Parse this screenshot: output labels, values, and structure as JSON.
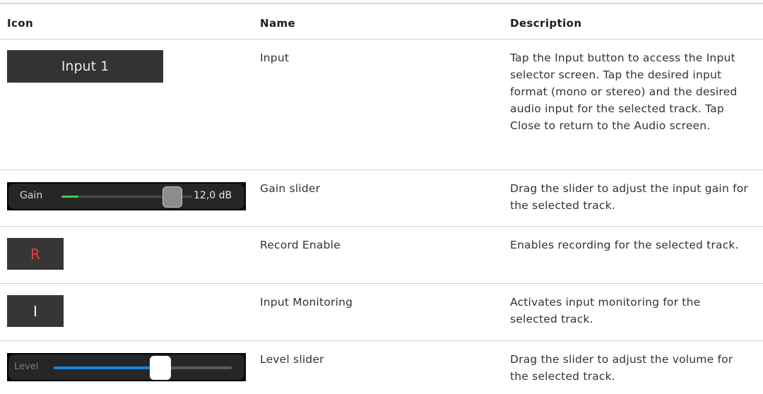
{
  "headers": {
    "icon": "Icon",
    "name": "Name",
    "description": "Description"
  },
  "rows": [
    {
      "icon_label": "Input 1",
      "name": "Input",
      "description": "Tap the Input button to access the Input selector screen. Tap the desired input format (mono or stereo) and the desired audio input for the selected track. Tap Close to return to the Audio screen."
    },
    {
      "icon_label": "Gain",
      "icon_value": "12,0 dB",
      "name": "Gain slider",
      "description": "Drag the slider to adjust the input gain for the selected track."
    },
    {
      "icon_label": "R",
      "name": "Record Enable",
      "description": "Enables recording for the selected track."
    },
    {
      "icon_label": "I",
      "name": "Input Monitoring",
      "description": "Activates input monitoring for the selected track."
    },
    {
      "icon_label": "Level",
      "name": "Level slider",
      "description": "Drag the slider to adjust the volume for the selected track."
    }
  ],
  "gain_slider": {
    "meter_fill": 0.13,
    "thumb_position": 0.78,
    "meter_color": "#3ad14a"
  },
  "level_slider": {
    "value": 0.6,
    "fill_color": "#1a82d8"
  },
  "colors": {
    "record": "#e8413a",
    "rule": "#d2d2d7",
    "button_bg": "#333333"
  }
}
